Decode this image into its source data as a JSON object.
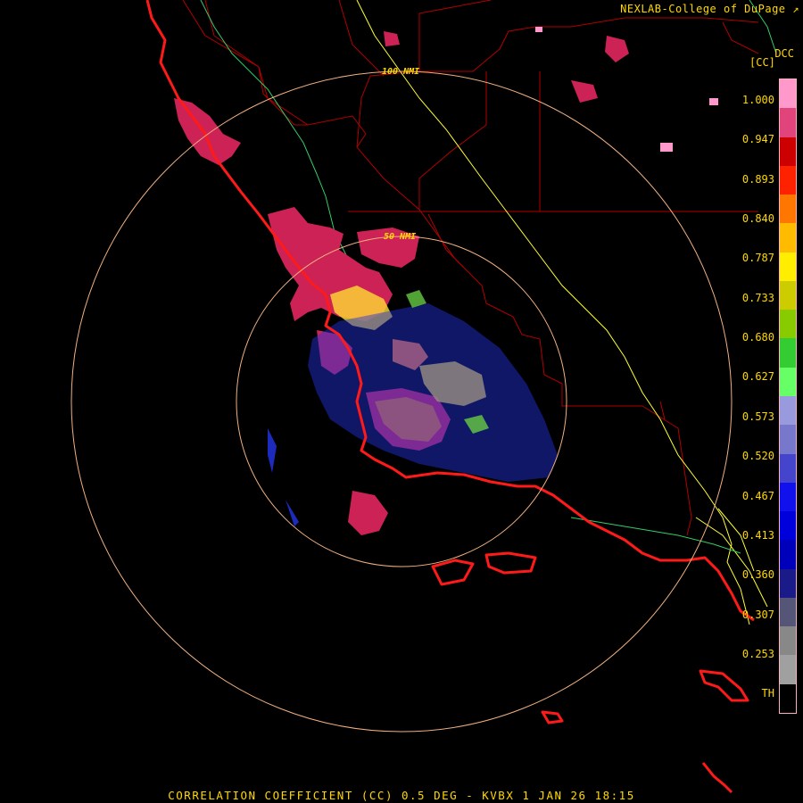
{
  "credit": "NEXLAB-College of DuPage",
  "product_code": "DCC",
  "units": "[CC]",
  "colorbar": {
    "tick_labels": [
      "1.000",
      "0.947",
      "0.893",
      "0.840",
      "0.787",
      "0.733",
      "0.680",
      "0.627",
      "0.573",
      "0.520",
      "0.467",
      "0.413",
      "0.360",
      "0.307",
      "0.253",
      "TH"
    ],
    "colors": [
      "#ff99cc",
      "#e0447a",
      "#cc0000",
      "#ff2200",
      "#ff7700",
      "#ffbb00",
      "#ffee00",
      "#cccc00",
      "#88cc00",
      "#33cc33",
      "#66ff66",
      "#9999dd",
      "#7777cc",
      "#4444cc",
      "#1111ee",
      "#0000dd",
      "#0000bb",
      "#1a1a88",
      "#555577",
      "#888888",
      "#a0a0a0",
      "#000000"
    ]
  },
  "range_rings": [
    {
      "label": "100 NMI"
    },
    {
      "label": "50 NMI"
    }
  ],
  "footer": "CORRELATION COEFFICIENT (CC) 0.5 DEG - KVBX 1 JAN 26 18:15",
  "icons": {
    "external_link": "external-link-icon"
  }
}
